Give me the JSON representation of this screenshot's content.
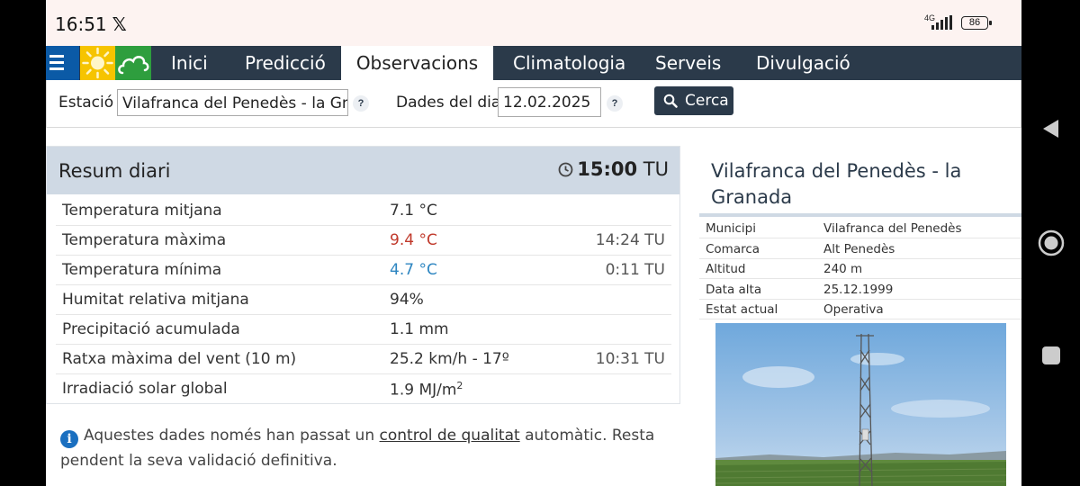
{
  "status_bar": {
    "time": "16:51",
    "x_icon": "x-logo-icon",
    "network": "4G",
    "battery": "86"
  },
  "nav": {
    "logo_icons": [
      "menu-icon",
      "sun-icon",
      "cloud-icon"
    ],
    "items": [
      {
        "label": "Inici"
      },
      {
        "label": "Predicció"
      },
      {
        "label": "Observacions",
        "active": true
      },
      {
        "label": "Climatologia"
      },
      {
        "label": "Serveis"
      },
      {
        "label": "Divulgació"
      }
    ]
  },
  "search": {
    "station_label": "Estació",
    "station_value": "Vilafranca del Penedès - la Gra",
    "date_label": "Dades del dia",
    "date_value": "12.02.2025",
    "help": "?",
    "button_label": "Cerca"
  },
  "summary": {
    "title": "Resum diari",
    "time_bold": "15:00",
    "time_unit": "TU",
    "rows": [
      {
        "label": "Temperatura mitjana",
        "value": "7.1 °C",
        "time": ""
      },
      {
        "label": "Temperatura màxima",
        "value": "9.4 °C",
        "time": "14:24 TU",
        "color": "#c0392b"
      },
      {
        "label": "Temperatura mínima",
        "value": "4.7 °C",
        "time": "0:11 TU",
        "color": "#2e86c1"
      },
      {
        "label": "Humitat relativa mitjana",
        "value": "94%",
        "time": ""
      },
      {
        "label": "Precipitació acumulada",
        "value": "1.1 mm",
        "time": ""
      },
      {
        "label": "Ratxa màxima del vent (10 m)",
        "value": "25.2 km/h - 17º",
        "time": "10:31 TU"
      },
      {
        "label": "Irradiació solar global",
        "value": "1.9 MJ/m",
        "sup": "2",
        "time": ""
      }
    ]
  },
  "notice": {
    "before": "Aquestes dades només han passat un ",
    "link": "control de qualitat",
    "after": " automàtic. Resta pendent la seva validació definitiva."
  },
  "station_info": {
    "title": "Vilafranca del Penedès - la Granada",
    "rows": [
      {
        "key": "Municipi",
        "value": "Vilafranca del Penedès"
      },
      {
        "key": "Comarca",
        "value": "Alt Penedès"
      },
      {
        "key": "Altitud",
        "value": "240 m"
      },
      {
        "key": "Data alta",
        "value": "25.12.1999"
      },
      {
        "key": "Estat actual",
        "value": "Operativa"
      }
    ]
  },
  "android_nav": [
    "back-icon",
    "home-icon",
    "recents-icon"
  ]
}
